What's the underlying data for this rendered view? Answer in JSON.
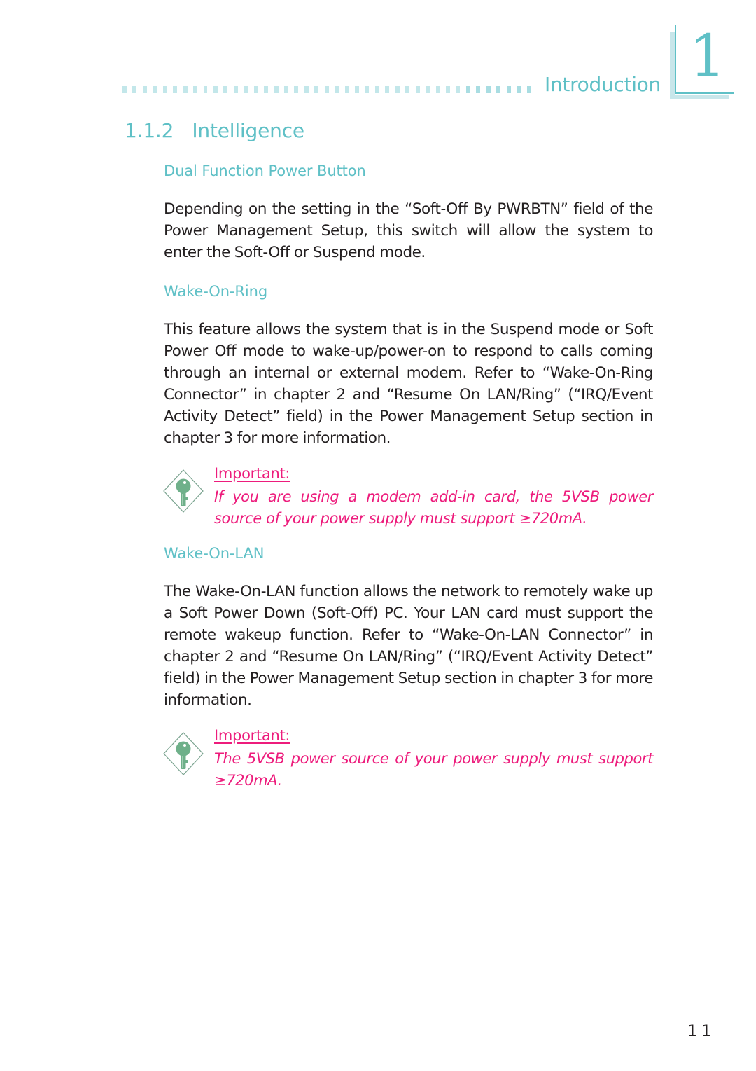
{
  "header": {
    "section_label": "Introduction",
    "chapter_number": "1",
    "bar_colors": {
      "light": "#c3e7ea",
      "dark": "#a9dde2"
    }
  },
  "section": {
    "number_title": "1.1.2   Intelligence"
  },
  "subsections": [
    {
      "title": "Dual Function Power Button",
      "paragraph": "Depending on the setting in the “Soft-Off By PWRBTN” field of the Power Management Setup, this switch will allow the system to enter the Soft-Off or Suspend mode."
    },
    {
      "title": "Wake-On-Ring",
      "paragraph": "This feature allows the system that is in the Suspend mode or Soft Power Off mode to wake-up/power-on to respond to calls coming through an internal or external modem. Refer to “Wake-On-Ring Connector” in chapter 2 and “Resume On LAN/Ring” (“IRQ/Event Activity Detect” field) in the Power Management Setup section in chapter 3 for more information.",
      "note": {
        "icon": "key-icon",
        "title": "Important:",
        "text": "If you are using a modem add-in card, the 5VSB power source of your power supply must support ≥720mA."
      }
    },
    {
      "title": "Wake-On-LAN",
      "paragraph": "The Wake-On-LAN function allows the network to remotely wake up a Soft Power Down (Soft-Off) PC. Your LAN card must support the remote wakeup function. Refer to “Wake-On-LAN Connector” in chapter 2 and “Resume On LAN/Ring” (“IRQ/Event Activity Detect” field) in the Power Management Setup section in chapter 3 for more information.",
      "note": {
        "icon": "key-icon",
        "title": "Important:",
        "text": "The 5VSB power source of your power supply must support ≥720mA."
      }
    }
  ],
  "footer": {
    "page_number": "11"
  },
  "colors": {
    "accent_teal": "#5fc0c6",
    "important_pink": "#ed1c7c",
    "key_green": "#6fb08a",
    "body_text": "#231f20"
  }
}
